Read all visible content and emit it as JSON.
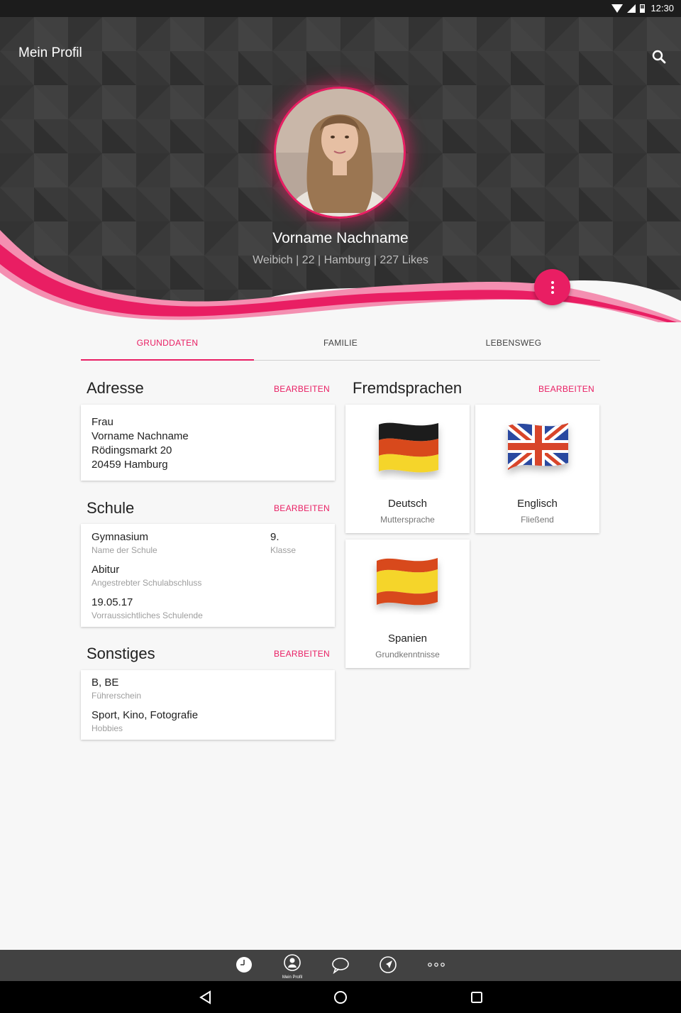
{
  "status_bar": {
    "time": "12:30"
  },
  "header": {
    "title": "Mein Profil",
    "name": "Vorname Nachname",
    "meta": "Weibich | 22 | Hamburg | 227 Likes",
    "accent": "#e91e63"
  },
  "tabs": [
    {
      "label": "GRUNDDATEN",
      "active": true
    },
    {
      "label": "FAMILIE",
      "active": false
    },
    {
      "label": "LEBENSWEG",
      "active": false
    }
  ],
  "edit_label": "BEARBEITEN",
  "adresse": {
    "title": "Adresse",
    "lines": [
      "Frau",
      "Vorname Nachname",
      "Rödingsmarkt 20",
      "20459 Hamburg"
    ]
  },
  "schule": {
    "title": "Schule",
    "school": {
      "value": "Gymnasium",
      "label": "Name der Schule"
    },
    "klasse": {
      "value": "9.",
      "label": "Klasse"
    },
    "abschluss": {
      "value": "Abitur",
      "label": "Angestrebter Schulabschluss"
    },
    "ende": {
      "value": "19.05.17",
      "label": "Vorraussichtliches Schulende"
    }
  },
  "sonstiges": {
    "title": "Sonstiges",
    "fuehrerschein": {
      "value": "B, BE",
      "label": "Führerschein"
    },
    "hobbies": {
      "value": "Sport, Kino, Fotografie",
      "label": "Hobbies"
    }
  },
  "fremdsprachen": {
    "title": "Fremdsprachen",
    "languages": [
      {
        "name": "Deutsch",
        "level": "Muttersprache",
        "flag": "germany-flag"
      },
      {
        "name": "Englisch",
        "level": "Fließend",
        "flag": "uk-flag"
      },
      {
        "name": "Spanien",
        "level": "Grundkenntnisse",
        "flag": "spain-flag"
      }
    ]
  },
  "bottom_nav": {
    "active_label": "Mein Profil",
    "items": [
      "clock-icon",
      "profile-icon",
      "chat-icon",
      "navigation-icon",
      "more-icon"
    ]
  }
}
